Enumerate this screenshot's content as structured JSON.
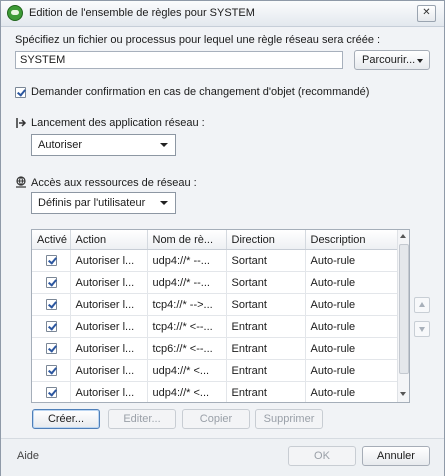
{
  "window": {
    "title": "Edition de l'ensemble de règles pour SYSTEM",
    "close_glyph": "✕"
  },
  "file": {
    "label": "Spécifiez un fichier ou processus pour lequel une règle réseau sera créée :",
    "value": "SYSTEM",
    "browse_label": "Parcourir..."
  },
  "confirm": {
    "label": "Demander confirmation en cas de changement d'objet (recommandé)",
    "checked": true
  },
  "launch": {
    "label": "Lancement des application réseau :",
    "selected": "Autoriser"
  },
  "access": {
    "label": "Accès aux ressources de réseau :",
    "selected": "Définis par l'utilisateur"
  },
  "table": {
    "headers": [
      "Activé",
      "Action",
      "Nom de rè...",
      "Direction",
      "Description"
    ],
    "rows": [
      {
        "enabled": true,
        "action": "Autoriser l...",
        "name": "udp4://* --...",
        "direction": "Sortant",
        "description": "Auto-rule"
      },
      {
        "enabled": true,
        "action": "Autoriser l...",
        "name": "udp4://* --...",
        "direction": "Sortant",
        "description": "Auto-rule"
      },
      {
        "enabled": true,
        "action": "Autoriser l...",
        "name": "tcp4://* -->...",
        "direction": "Sortant",
        "description": "Auto-rule"
      },
      {
        "enabled": true,
        "action": "Autoriser l...",
        "name": "tcp4://* <--...",
        "direction": "Entrant",
        "description": "Auto-rule"
      },
      {
        "enabled": true,
        "action": "Autoriser l...",
        "name": "tcp6://* <--...",
        "direction": "Entrant",
        "description": "Auto-rule"
      },
      {
        "enabled": true,
        "action": "Autoriser l...",
        "name": "udp4://* <...",
        "direction": "Entrant",
        "description": "Auto-rule"
      },
      {
        "enabled": true,
        "action": "Autoriser l...",
        "name": "udp4://* <...",
        "direction": "Entrant",
        "description": "Auto-rule"
      }
    ]
  },
  "rule_buttons": {
    "create": "Créer...",
    "edit": "Editer...",
    "copy": "Copier",
    "delete": "Supprimer"
  },
  "footer": {
    "help": "Aide",
    "ok": "OK",
    "cancel": "Annuler"
  },
  "colors": {
    "accent": "#2c57a0",
    "app_icon": "#3d9a36"
  }
}
